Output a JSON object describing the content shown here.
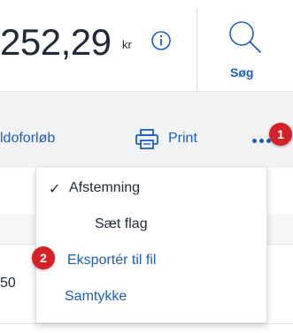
{
  "header": {
    "balance_amount": "252,29",
    "balance_currency": "kr",
    "search_label": "Søg"
  },
  "action_bar": {
    "saldo_label": "ldoforløb",
    "print_label": "Print",
    "more_icon": "more-horizontal-icon"
  },
  "menu": {
    "check_mark": "✓",
    "items": [
      {
        "label": "Afstemning",
        "checked": true
      },
      {
        "label": "Sæt flag",
        "checked": false
      },
      {
        "label": "Eksportér til fil",
        "checked": false
      },
      {
        "label": "Samtykke",
        "checked": false
      }
    ]
  },
  "background_row": {
    "text": "50"
  },
  "annotations": {
    "badge_1": "1",
    "badge_2": "2"
  },
  "colors": {
    "accent": "#1b5fb8",
    "badge": "#d42027",
    "action_bar_bg": "#f1f2f4",
    "text": "#1f2937"
  }
}
